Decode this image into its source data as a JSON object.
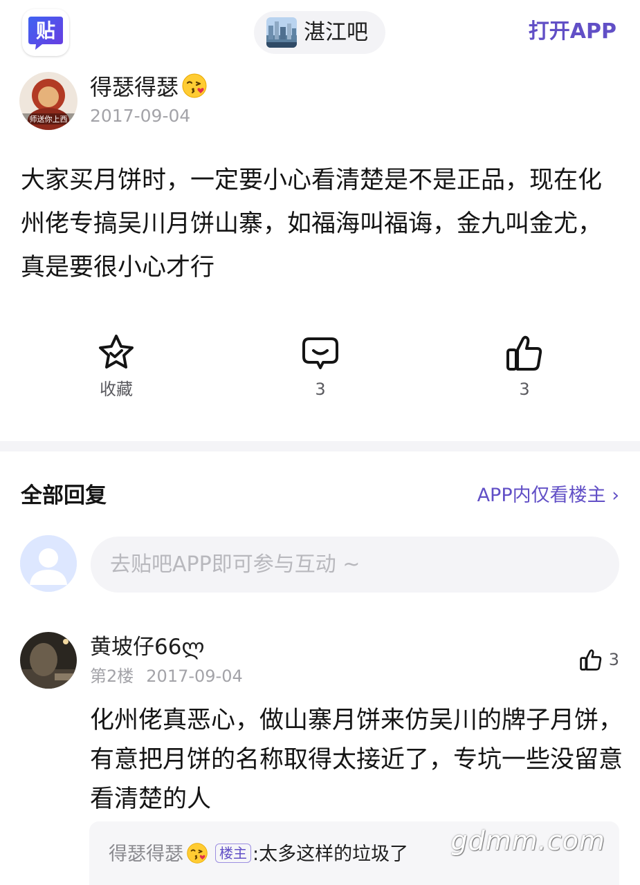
{
  "header": {
    "app_logo_char": "贴",
    "bar_name": "湛江吧",
    "open_app_label": "打开APP"
  },
  "post": {
    "author": "得瑟得瑟",
    "avatar_caption": "师送你上西",
    "date": "2017-09-04",
    "body": "大家买月饼时，一定要小心看清楚是不是正品，现在化州佬专搞吴川月饼山寨，如福海叫福诲，金九叫金尤，真是要很小心才行",
    "actions": {
      "collect_label": "收藏",
      "comment_count": "3",
      "like_count": "3"
    }
  },
  "replies": {
    "title": "全部回复",
    "only_op_label": "APP内仅看楼主 ›",
    "input_placeholder": "去贴吧APP即可参与互动 ~",
    "floors": [
      {
        "author": "黄坡仔66ლ",
        "floor": "第2楼",
        "date": "2017-09-04",
        "like_count": "3",
        "body": "化州佬真恶心，做山寨月饼来仿吴川的牌子月饼，有意把月饼的名称取得太接近了，专坑一些没留意看清楚的人",
        "sub_reply": {
          "author": "得瑟得瑟",
          "badge": "楼主",
          "text": ":太多这样的垃圾了"
        }
      }
    ]
  },
  "watermark": "gdmm.com",
  "colors": {
    "accent": "#614fc6",
    "muted": "#a3a3a8",
    "divider": "#f4f4f7"
  }
}
